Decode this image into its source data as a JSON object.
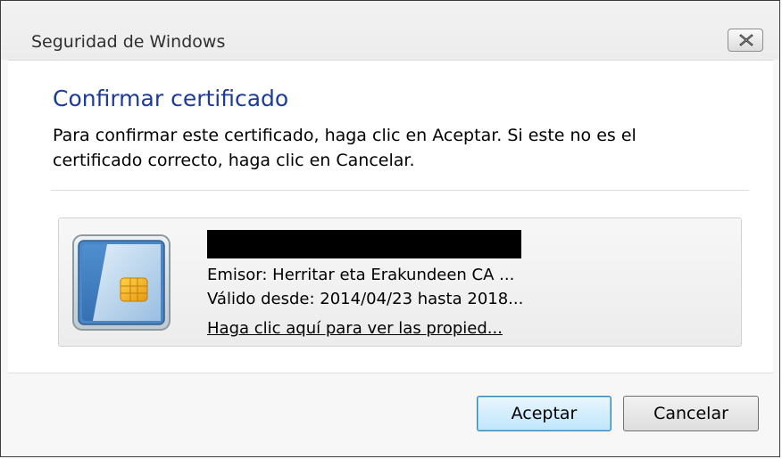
{
  "window": {
    "title": "Seguridad de Windows"
  },
  "dialog": {
    "heading": "Confirmar certificado",
    "message": "Para confirmar este certificado, haga clic en Aceptar. Si este no es el certificado correcto, haga clic en Cancelar."
  },
  "certificate": {
    "issuer": "Emisor: Herritar eta Erakundeen CA ...",
    "validity": "Válido desde: 2014/04/23 hasta 2018...",
    "properties_link": "Haga clic aquí para ver las propied..."
  },
  "buttons": {
    "accept_label": "Aceptar",
    "cancel_label": "Cancelar"
  },
  "icons": {
    "close": "close-icon",
    "certificate": "smart-card-icon"
  },
  "colors": {
    "heading": "#1e3c96",
    "default_button": "#bee6fd"
  }
}
